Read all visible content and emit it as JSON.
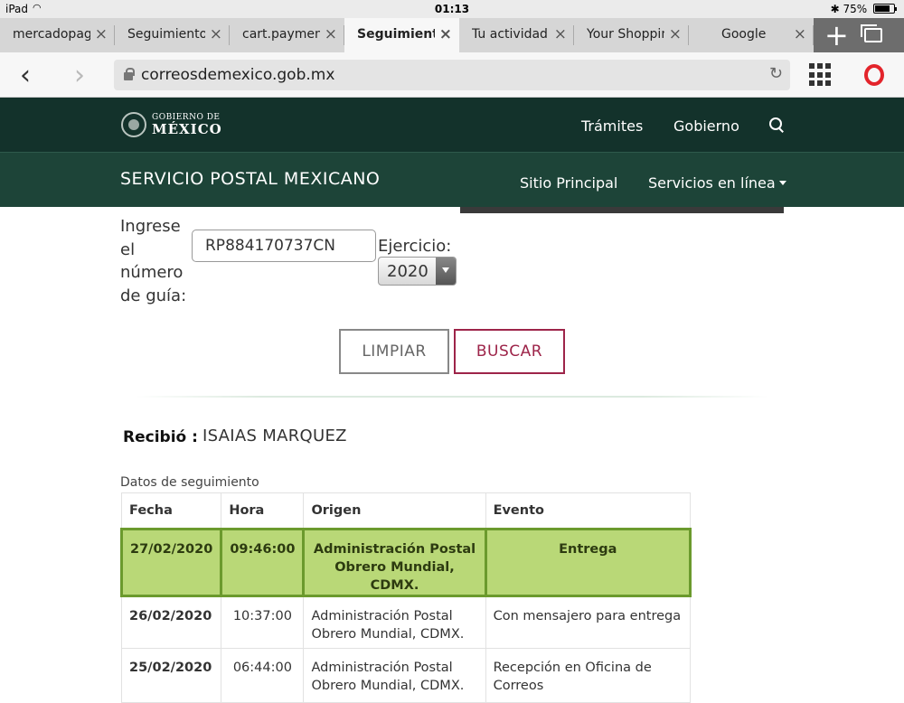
{
  "status_bar": {
    "device": "iPad",
    "time": "01:13",
    "battery": "75%"
  },
  "browser": {
    "tabs": [
      {
        "label": "mercadopago",
        "active": false
      },
      {
        "label": "Seguimiento",
        "active": false
      },
      {
        "label": "cart.payment",
        "active": false
      },
      {
        "label": "Seguimiento",
        "active": true
      },
      {
        "label": "Tu actividad",
        "active": false
      },
      {
        "label": "Your Shopping",
        "active": false
      },
      {
        "label": "Google",
        "active": false
      }
    ],
    "url": "correosdemexico.gob.mx",
    "icons": {
      "close": "×",
      "new_tab": "+",
      "back": "‹",
      "forward": "›",
      "reload": "↻"
    }
  },
  "header": {
    "logo_line1": "GOBIERNO DE",
    "logo_line2": "MÉXICO",
    "nav": [
      "Trámites",
      "Gobierno"
    ],
    "service_title": "SERVICIO POSTAL MEXICANO",
    "service_nav": [
      "Sitio Principal",
      "Servicios en línea"
    ]
  },
  "form": {
    "guide_label": "Ingrese el número de guía:",
    "guide_value": "RP884170737CN",
    "year_label": "Ejercicio:",
    "year_value": "2020",
    "clear_label": "LIMPIAR",
    "search_label": "BUSCAR"
  },
  "result": {
    "received_label": "Recibió :",
    "received_name": "ISAIAS MARQUEZ",
    "caption": "Datos de seguimiento",
    "columns": [
      "Fecha",
      "Hora",
      "Origen",
      "Evento"
    ],
    "rows": [
      {
        "fecha": "27/02/2020",
        "hora": "09:46:00",
        "origen": "Administración Postal Obrero Mundial, CDMX.",
        "evento": "Entrega"
      },
      {
        "fecha": "26/02/2020",
        "hora": "10:37:00",
        "origen": "Administración Postal Obrero Mundial, CDMX.",
        "evento": "Con mensajero para entrega"
      },
      {
        "fecha": "25/02/2020",
        "hora": "06:44:00",
        "origen": "Administración Postal Obrero Mundial, CDMX.",
        "evento": "Recepción en Oficina de Correos"
      }
    ]
  },
  "colors": {
    "header_dark": "#13322b",
    "service_bar": "#1d4438",
    "accent_buscar": "#9d2449",
    "row_highlight": "#b9d877",
    "row_highlight_border": "#6b9a2d"
  }
}
